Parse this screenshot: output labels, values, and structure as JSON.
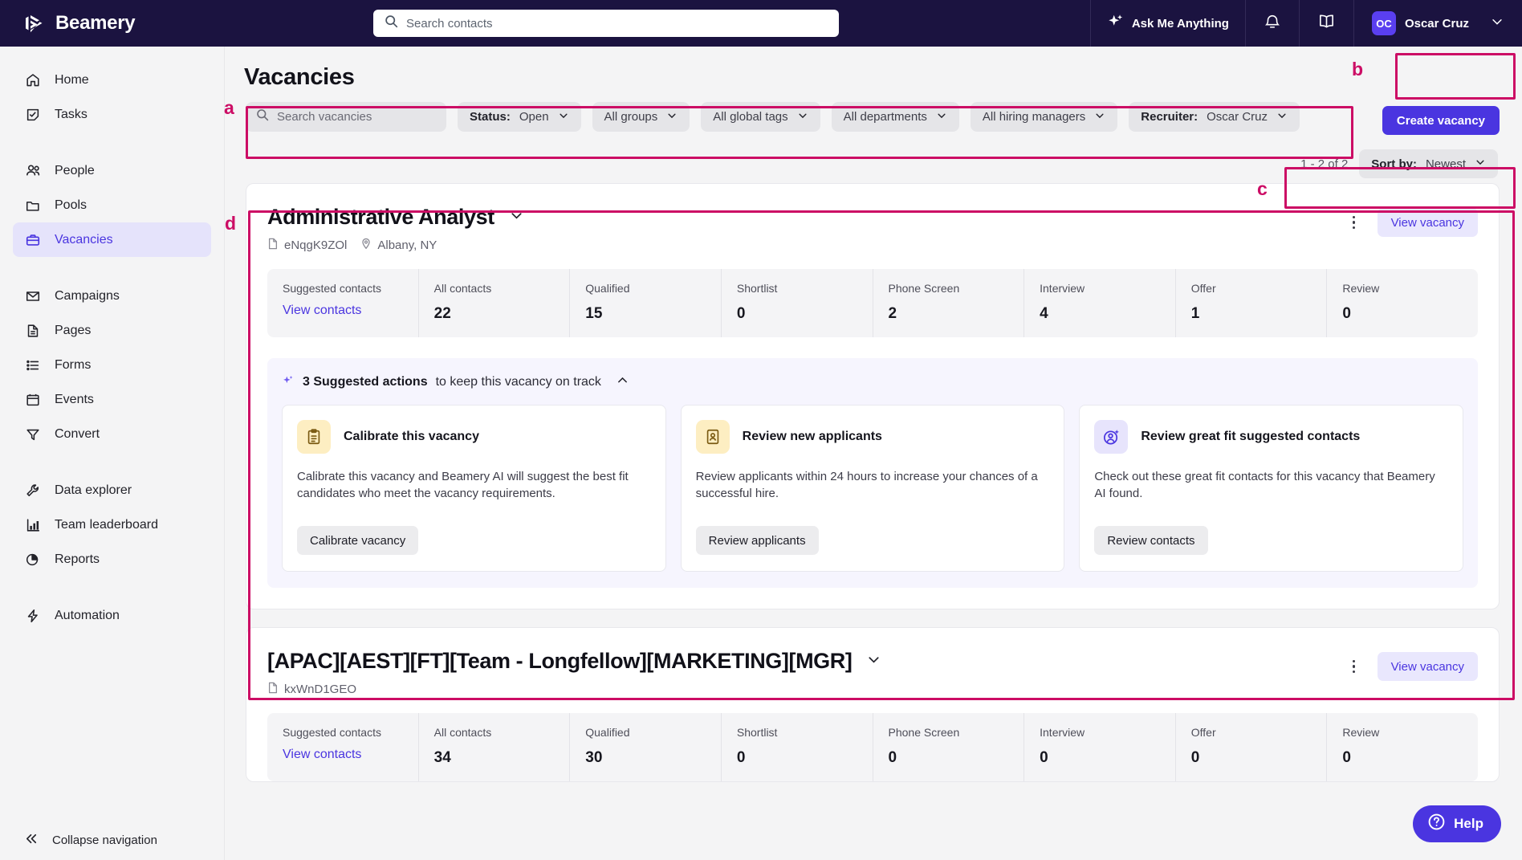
{
  "topbar": {
    "brand": "Beamery",
    "search_placeholder": "Search contacts",
    "search_value": "",
    "ask_me_anything": "Ask Me Anything",
    "user_initials": "OC",
    "user_name": "Oscar Cruz"
  },
  "sidebar": {
    "items": [
      {
        "label": "Home",
        "icon": "home-icon",
        "active": false
      },
      {
        "label": "Tasks",
        "icon": "tasks-icon",
        "active": false
      },
      {
        "label": "People",
        "icon": "people-icon",
        "active": false
      },
      {
        "label": "Pools",
        "icon": "folder-icon",
        "active": false
      },
      {
        "label": "Vacancies",
        "icon": "briefcase-icon",
        "active": true
      },
      {
        "label": "Campaigns",
        "icon": "envelope-icon",
        "active": false
      },
      {
        "label": "Pages",
        "icon": "document-icon",
        "active": false
      },
      {
        "label": "Forms",
        "icon": "list-icon",
        "active": false
      },
      {
        "label": "Events",
        "icon": "calendar-icon",
        "active": false
      },
      {
        "label": "Convert",
        "icon": "funnel-icon",
        "active": false
      },
      {
        "label": "Data explorer",
        "icon": "wrench-icon",
        "active": false
      },
      {
        "label": "Team leaderboard",
        "icon": "bar-chart-icon",
        "active": false
      },
      {
        "label": "Reports",
        "icon": "pie-chart-icon",
        "active": false
      },
      {
        "label": "Automation",
        "icon": "lightning-icon",
        "active": false
      }
    ],
    "collapse_label": "Collapse navigation"
  },
  "page": {
    "title": "Vacancies",
    "create_button": "Create vacancy"
  },
  "filters": {
    "search_placeholder": "Search vacancies",
    "search_value": "",
    "chips": [
      {
        "prefix": "Status:",
        "value": "Open"
      },
      {
        "prefix": "",
        "value": "All groups"
      },
      {
        "prefix": "",
        "value": "All global tags"
      },
      {
        "prefix": "",
        "value": "All departments"
      },
      {
        "prefix": "",
        "value": "All hiring managers"
      },
      {
        "prefix": "Recruiter:",
        "value": "Oscar Cruz"
      }
    ]
  },
  "results": {
    "count_text": "1 - 2 of 2",
    "sort_prefix": "Sort by:",
    "sort_value": "Newest"
  },
  "vacancies": [
    {
      "title": "Administrative Analyst",
      "ref_id": "eNqgK9ZOl",
      "location": "Albany, NY",
      "view_button": "View vacancy",
      "stats": [
        {
          "label": "Suggested contacts",
          "link": "View contacts"
        },
        {
          "label": "All contacts",
          "value": "22"
        },
        {
          "label": "Qualified",
          "value": "15"
        },
        {
          "label": "Shortlist",
          "value": "0"
        },
        {
          "label": "Phone Screen",
          "value": "2"
        },
        {
          "label": "Interview",
          "value": "4"
        },
        {
          "label": "Offer",
          "value": "1"
        },
        {
          "label": "Review",
          "value": "0"
        }
      ],
      "suggested": {
        "count_label": "3 Suggested actions",
        "tail_label": "to keep this vacancy on track",
        "cards": [
          {
            "icon": "clipboard-icon",
            "icon_style": "yellow",
            "title": "Calibrate this vacancy",
            "body": "Calibrate this vacancy and Beamery AI will suggest the best fit candidates who meet the vacancy requirements.",
            "button": "Calibrate vacancy"
          },
          {
            "icon": "applicant-icon",
            "icon_style": "yellow",
            "title": "Review new applicants",
            "body": "Review applicants within 24 hours to increase your chances of a successful hire.",
            "button": "Review applicants"
          },
          {
            "icon": "great-fit-contact-icon",
            "icon_style": "purple",
            "title": "Review great fit suggested contacts",
            "body": "Check out these great fit contacts for this vacancy that Beamery AI found.",
            "button": "Review contacts"
          }
        ]
      }
    },
    {
      "title": "[APAC][AEST][FT][Team - Longfellow][MARKETING][MGR]",
      "ref_id": "kxWnD1GEO",
      "location": "",
      "view_button": "View vacancy",
      "stats": [
        {
          "label": "Suggested contacts",
          "link": "View contacts"
        },
        {
          "label": "All contacts",
          "value": "34"
        },
        {
          "label": "Qualified",
          "value": "30"
        },
        {
          "label": "Shortlist",
          "value": "0"
        },
        {
          "label": "Phone Screen",
          "value": "0"
        },
        {
          "label": "Interview",
          "value": "0"
        },
        {
          "label": "Offer",
          "value": "0"
        },
        {
          "label": "Review",
          "value": "0"
        }
      ]
    }
  ],
  "annotations": [
    {
      "label": "a"
    },
    {
      "label": "b"
    },
    {
      "label": "c"
    },
    {
      "label": "d"
    }
  ],
  "help": {
    "label": "Help"
  },
  "colors": {
    "brand_dark": "#1b1340",
    "accent_purple": "#4a35e0",
    "annotation_pink": "#cc0d65"
  }
}
